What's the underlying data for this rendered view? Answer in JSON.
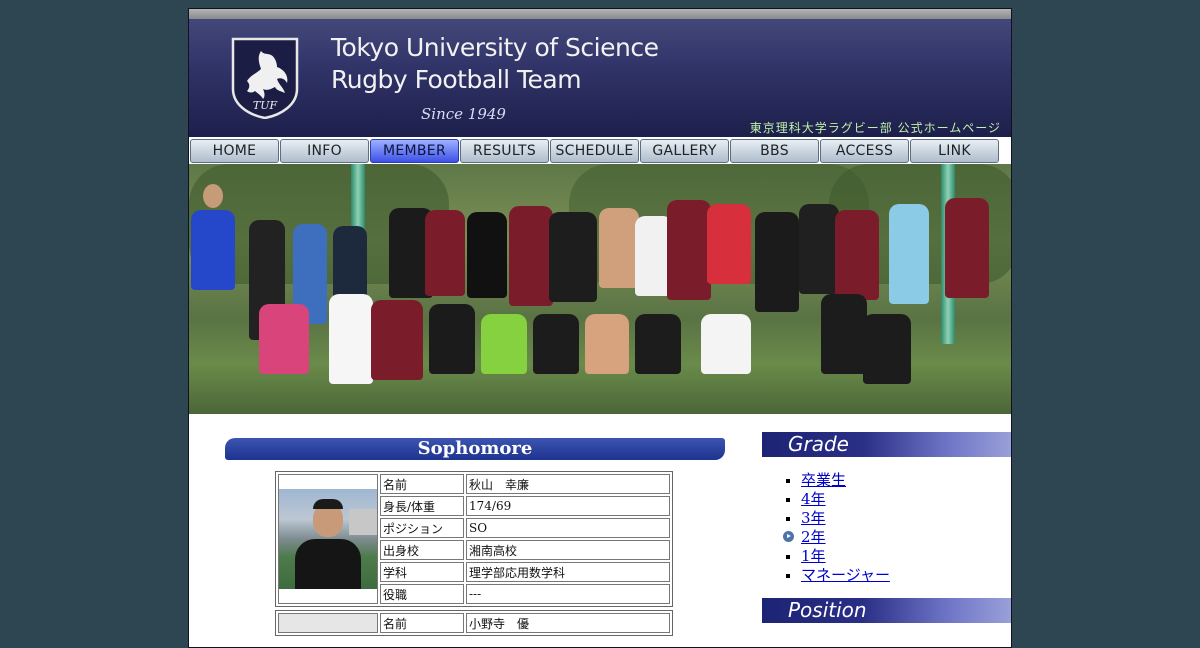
{
  "header": {
    "title_line1": "Tokyo University of Science",
    "title_line2": "Rugby Football Team",
    "since": "Since 1949",
    "subtitle_jp": "東京理科大学ラグビー部 公式ホームページ",
    "logo_text": "TUF"
  },
  "nav": [
    {
      "label": "HOME",
      "active": false
    },
    {
      "label": "INFO",
      "active": false
    },
    {
      "label": "MEMBER",
      "active": true
    },
    {
      "label": "RESULTS",
      "active": false
    },
    {
      "label": "SCHEDULE",
      "active": false
    },
    {
      "label": "GALLERY",
      "active": false
    },
    {
      "label": "BBS",
      "active": false
    },
    {
      "label": "ACCESS",
      "active": false
    },
    {
      "label": "LINK",
      "active": false
    }
  ],
  "section": {
    "title": "Sophomore"
  },
  "members": [
    {
      "rows": [
        {
          "label": "名前",
          "value": "秋山　幸廉"
        },
        {
          "label": "身長/体重",
          "value": "174/69"
        },
        {
          "label": "ポジション",
          "value": "SO"
        },
        {
          "label": "出身校",
          "value": "湘南高校"
        },
        {
          "label": "学科",
          "value": "理学部応用数学科"
        },
        {
          "label": "役職",
          "value": "---"
        }
      ]
    },
    {
      "rows": [
        {
          "label": "名前",
          "value": "小野寺　優"
        }
      ]
    }
  ],
  "sidebar": {
    "grade_heading": "Grade",
    "grades": [
      {
        "label": "卒業生",
        "current": false
      },
      {
        "label": "4年",
        "current": false
      },
      {
        "label": "3年",
        "current": false
      },
      {
        "label": "2年",
        "current": true
      },
      {
        "label": "1年",
        "current": false
      },
      {
        "label": "マネージャー",
        "current": false
      }
    ],
    "position_heading": "Position"
  },
  "colors": {
    "page_bg": "#2d4651",
    "header_bg": "#2f3266",
    "section_bar": "#1e3390",
    "active_nav": "#3d52e6",
    "link": "#0000cc"
  }
}
